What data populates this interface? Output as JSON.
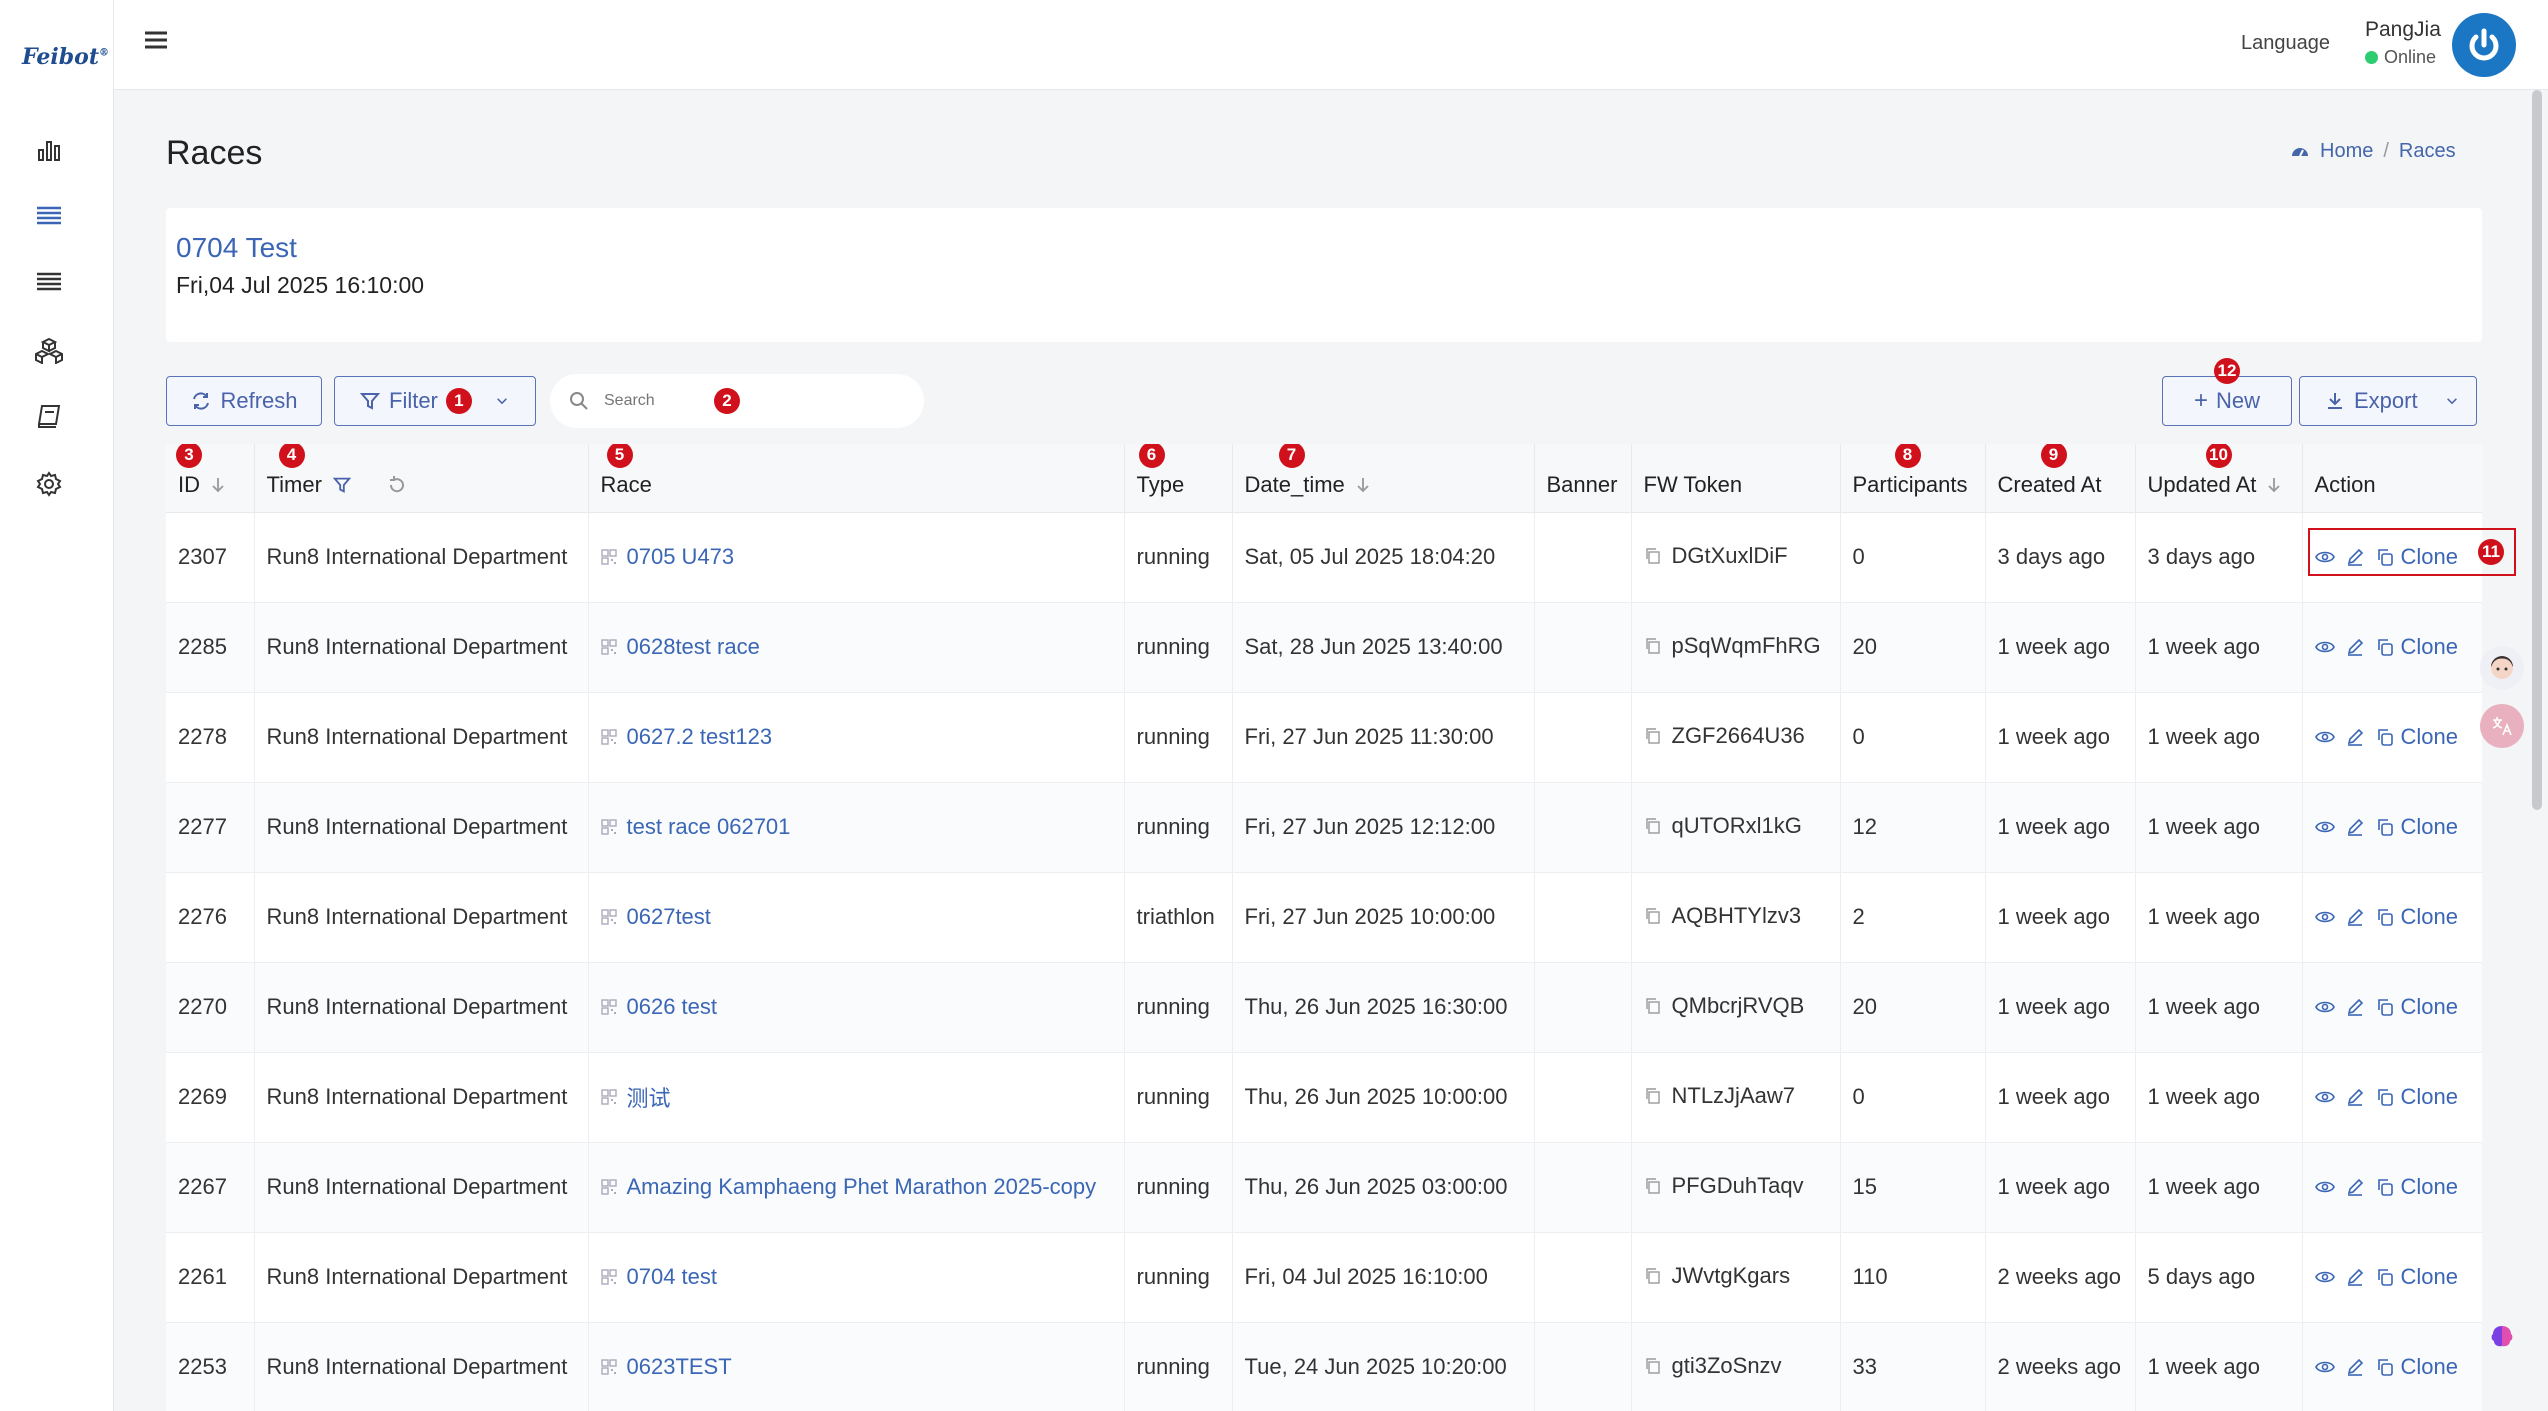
{
  "app": {
    "logo": "Feibot",
    "logo_mark": "®"
  },
  "topbar": {
    "language": "Language",
    "username": "PangJia",
    "status": "Online"
  },
  "page": {
    "title": "Races",
    "breadcrumb": [
      "Home",
      "Races"
    ]
  },
  "race_card": {
    "title": "0704 Test",
    "date": "Fri,04 Jul 2025 16:10:00"
  },
  "toolbar": {
    "refresh": "Refresh",
    "filter": "Filter",
    "search_placeholder": "Search",
    "new": "New",
    "export": "Export"
  },
  "annotations": {
    "filter": "1",
    "search": "2",
    "id": "3",
    "timer": "4",
    "race": "5",
    "type": "6",
    "date_time": "7",
    "participants": "8",
    "created_at": "9",
    "updated_at": "10",
    "action": "11",
    "new": "12"
  },
  "table": {
    "columns": [
      "ID",
      "Timer",
      "Race",
      "Type",
      "Date_time",
      "Banner",
      "FW Token",
      "Participants",
      "Created At",
      "Updated At",
      "Action"
    ],
    "action_label": "Clone",
    "rows": [
      {
        "id": "2307",
        "timer": "Run8 International Department",
        "race": "0705 U473",
        "type": "running",
        "date_time": "Sat, 05 Jul 2025 18:04:20",
        "banner": "",
        "token": "DGtXuxlDiF",
        "participants": "0",
        "created": "3 days ago",
        "updated": "3 days ago"
      },
      {
        "id": "2285",
        "timer": "Run8 International Department",
        "race": "0628test race",
        "type": "running",
        "date_time": "Sat, 28 Jun 2025 13:40:00",
        "banner": "",
        "token": "pSqWqmFhRG",
        "participants": "20",
        "created": "1 week ago",
        "updated": "1 week ago"
      },
      {
        "id": "2278",
        "timer": "Run8 International Department",
        "race": "0627.2 test123",
        "type": "running",
        "date_time": "Fri, 27 Jun 2025 11:30:00",
        "banner": "",
        "token": "ZGF2664U36",
        "participants": "0",
        "created": "1 week ago",
        "updated": "1 week ago"
      },
      {
        "id": "2277",
        "timer": "Run8 International Department",
        "race": "test race 062701",
        "type": "running",
        "date_time": "Fri, 27 Jun 2025 12:12:00",
        "banner": "",
        "token": "qUTORxl1kG",
        "participants": "12",
        "created": "1 week ago",
        "updated": "1 week ago"
      },
      {
        "id": "2276",
        "timer": "Run8 International Department",
        "race": "0627test",
        "type": "triathlon",
        "date_time": "Fri, 27 Jun 2025 10:00:00",
        "banner": "",
        "token": "AQBHTYlzv3",
        "participants": "2",
        "created": "1 week ago",
        "updated": "1 week ago"
      },
      {
        "id": "2270",
        "timer": "Run8 International Department",
        "race": "0626 test",
        "type": "running",
        "date_time": "Thu, 26 Jun 2025 16:30:00",
        "banner": "",
        "token": "QMbcrjRVQB",
        "participants": "20",
        "created": "1 week ago",
        "updated": "1 week ago"
      },
      {
        "id": "2269",
        "timer": "Run8 International Department",
        "race": "测试",
        "type": "running",
        "date_time": "Thu, 26 Jun 2025 10:00:00",
        "banner": "",
        "token": "NTLzJjAaw7",
        "participants": "0",
        "created": "1 week ago",
        "updated": "1 week ago"
      },
      {
        "id": "2267",
        "timer": "Run8 International Department",
        "race": "Amazing Kamphaeng Phet Marathon 2025-copy",
        "type": "running",
        "date_time": "Thu, 26 Jun 2025 03:00:00",
        "banner": "",
        "token": "PFGDuhTaqv",
        "participants": "15",
        "created": "1 week ago",
        "updated": "1 week ago"
      },
      {
        "id": "2261",
        "timer": "Run8 International Department",
        "race": "0704 test",
        "type": "running",
        "date_time": "Fri, 04 Jul 2025 16:10:00",
        "banner": "",
        "token": "JWvtgKgars",
        "participants": "110",
        "created": "2 weeks ago",
        "updated": "5 days ago"
      },
      {
        "id": "2253",
        "timer": "Run8 International Department",
        "race": "0623TEST",
        "type": "running",
        "date_time": "Tue, 24 Jun 2025 10:20:00",
        "banner": "",
        "token": "gti3ZoSnzv",
        "participants": "33",
        "created": "2 weeks ago",
        "updated": "1 week ago"
      }
    ]
  },
  "colors": {
    "accent": "#3a66b5",
    "badge": "#d0101b",
    "online": "#2ecc71",
    "avatar": "#1b76c4"
  }
}
